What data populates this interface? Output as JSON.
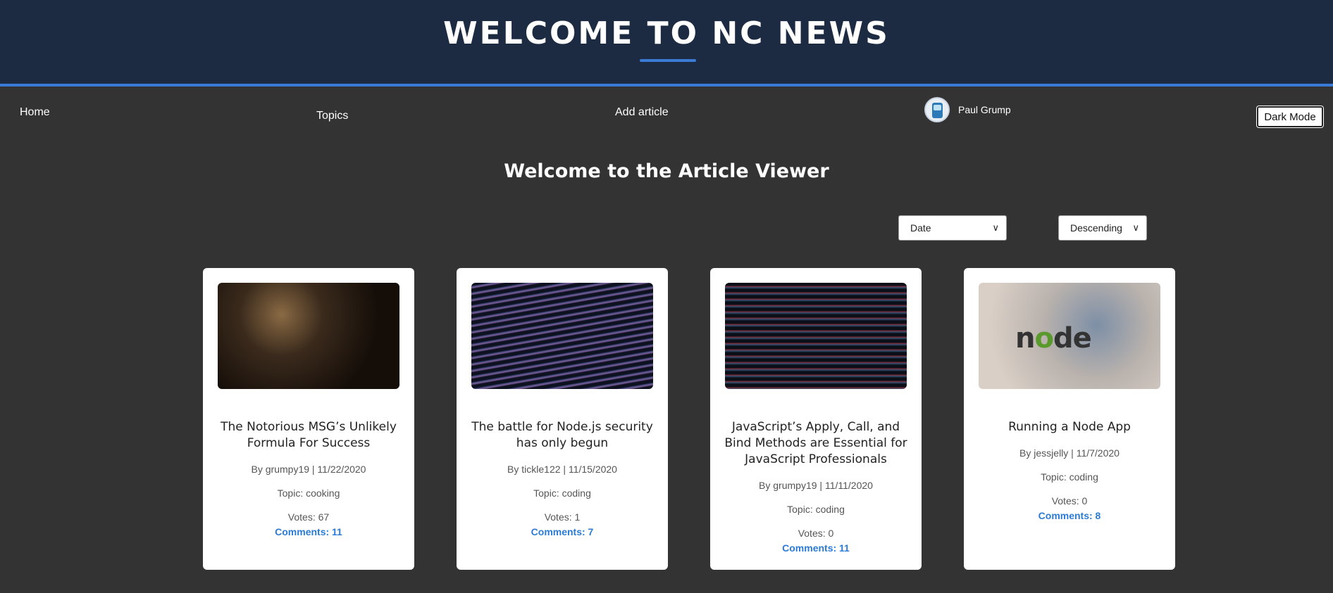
{
  "header": {
    "title": "WELCOME TO NC NEWS"
  },
  "nav": {
    "home": "Home",
    "topics": "Topics",
    "add_article": "Add article",
    "user_name": "Paul Grump",
    "dark_mode": "Dark Mode"
  },
  "main": {
    "heading": "Welcome to the Article Viewer",
    "sort_by": "Date",
    "order": "Descending"
  },
  "articles": [
    {
      "title": "The Notorious MSG’s Unlikely Formula For Success",
      "byline": "By grumpy19 | 11/22/2020",
      "topic": "Topic: cooking",
      "votes": "Votes: 67",
      "comments": "Comments: 11"
    },
    {
      "title": "The battle for Node.js security has only begun",
      "byline": "By tickle122 | 11/15/2020",
      "topic": "Topic: coding",
      "votes": "Votes: 1",
      "comments": "Comments: 7"
    },
    {
      "title": "JavaScript’s Apply, Call, and Bind Methods are Essential for JavaScript Professionals",
      "byline": "By grumpy19 | 11/11/2020",
      "topic": "Topic: coding",
      "votes": "Votes: 0",
      "comments": "Comments: 11"
    },
    {
      "title": "Running a Node App",
      "byline": "By jessjelly | 11/7/2020",
      "topic": "Topic: coding",
      "votes": "Votes: 0",
      "comments": "Comments: 8"
    }
  ]
}
